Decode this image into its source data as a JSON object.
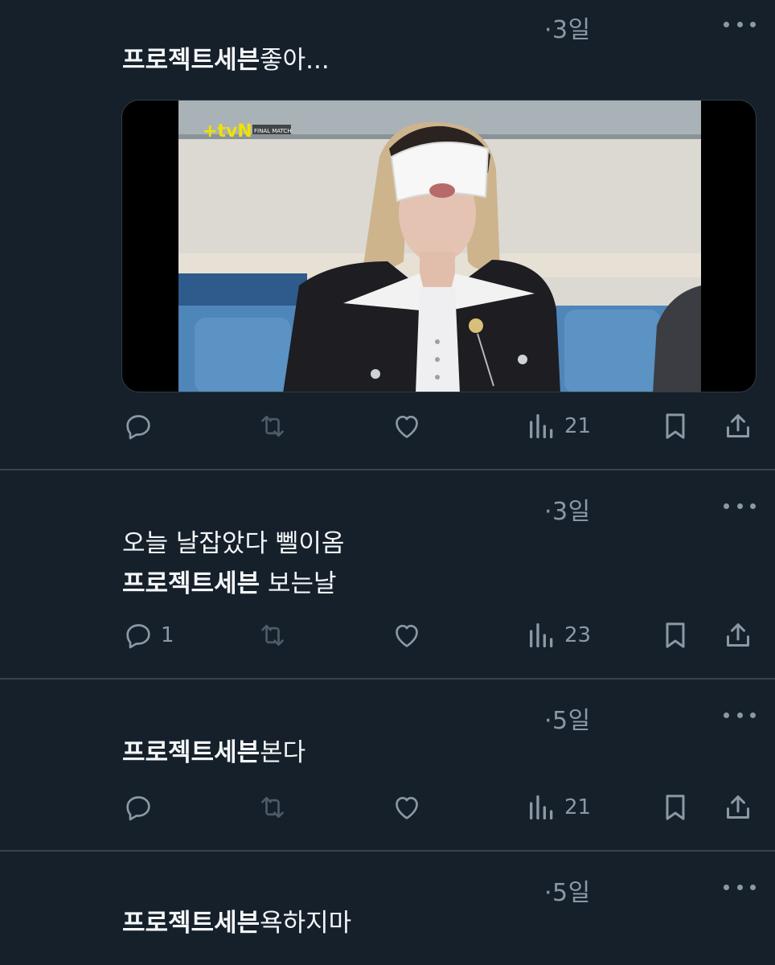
{
  "tweets": [
    {
      "time": "·3일",
      "highlight": "프로젝트세븐",
      "text_after": "좋아...",
      "line2_highlight": "",
      "line2_after": "",
      "has_media": true,
      "media": {
        "logo": "+tvN",
        "badge": "FINAL MATCH"
      },
      "reply_count": "",
      "views": "21"
    },
    {
      "time": "·3일",
      "line1": "오늘 날잡았다 뻴이옴",
      "highlight": "프로젝트세븐",
      "text_after": " 보는날",
      "reply_count": "1",
      "views": "23"
    },
    {
      "time": "·5일",
      "highlight": "프로젝트세븐",
      "text_after": "본다",
      "reply_count": "",
      "views": "21"
    },
    {
      "time": "·5일",
      "highlight": "프로젝트세븐",
      "text_after": "욕하지마"
    }
  ],
  "icons": {
    "reply": "reply-icon",
    "retweet": "retweet-icon",
    "like": "heart-icon",
    "views": "views-chart-icon",
    "bookmark": "bookmark-icon",
    "share": "share-icon",
    "more": "more-dots-icon"
  },
  "colors": {
    "background": "#15202b",
    "text": "#e7e9ea",
    "muted": "#8b98a5",
    "divider": "#38444d"
  }
}
